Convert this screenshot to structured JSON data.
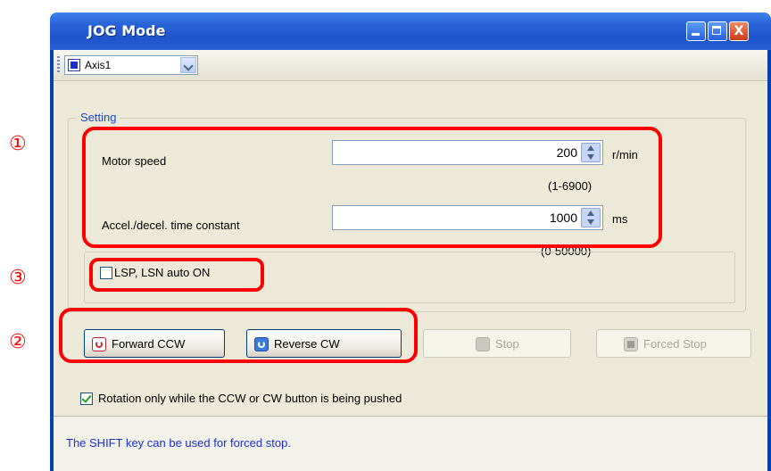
{
  "window": {
    "title": "JOG Mode",
    "close_glyph": "X"
  },
  "toolbar": {
    "axis_value": "Axis1"
  },
  "setting": {
    "group_label": "Setting",
    "motor_speed": {
      "label": "Motor speed",
      "value": "200",
      "unit": "r/min",
      "range": "(1-6900)"
    },
    "accel": {
      "label": "Accel./decel. time constant",
      "value": "1000",
      "unit": "ms",
      "range": "(0-50000)"
    },
    "lsp_lsn_label": "LSP, LSN auto ON",
    "lsp_lsn_checked": false
  },
  "buttons": {
    "forward": "Forward CCW",
    "reverse": "Reverse CW",
    "stop": "Stop",
    "forced_stop": "Forced Stop"
  },
  "rotation_only": {
    "label": "Rotation only while the CCW or CW button is being pushed",
    "checked": true
  },
  "status_text": "The SHIFT key can be used for forced stop.",
  "annotations": {
    "marker1": "①",
    "marker2": "②",
    "marker3": "③",
    "color": "#ff0000"
  },
  "colors": {
    "titlebar": "#2a64d8",
    "client_bg": "#ece9d8",
    "status_text": "#1a2fd0"
  }
}
